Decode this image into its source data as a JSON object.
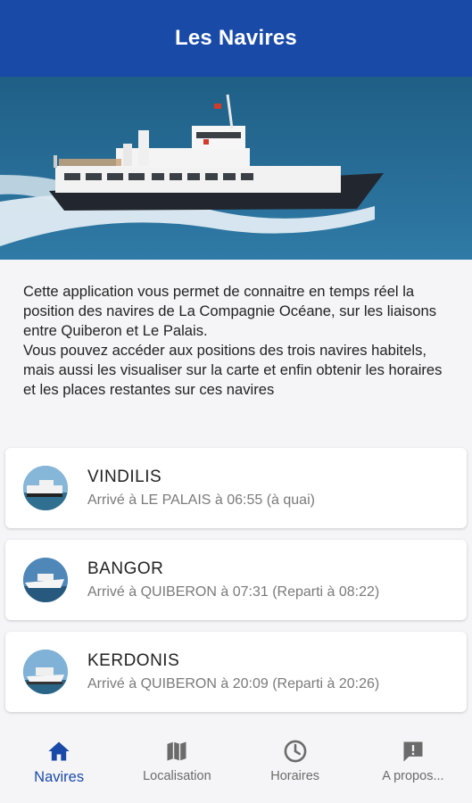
{
  "header": {
    "title": "Les Navires"
  },
  "intro": {
    "paragraph1": "Cette application vous permet de connaitre en temps réel la position des navires de La Compagnie Océane, sur les liaisons entre Quiberon et Le Palais.",
    "paragraph2": "Vous pouvez accéder aux positions des trois navires habitels, mais aussi les visualiser sur la carte et enfin obtenir les horaires et les places restantes sur ces navires"
  },
  "ships": [
    {
      "name": "VINDILIS",
      "status": "Arrivé à LE PALAIS à 06:55 (à quai)"
    },
    {
      "name": "BANGOR",
      "status": "Arrivé à QUIBERON à 07:31 (Reparti à 08:22)"
    },
    {
      "name": "KERDONIS",
      "status": "Arrivé à QUIBERON à 20:09 (Reparti à 20:26)"
    }
  ],
  "tabs": [
    {
      "label": "Navires",
      "icon": "home-icon",
      "active": true
    },
    {
      "label": "Localisation",
      "icon": "map-icon",
      "active": false
    },
    {
      "label": "Horaires",
      "icon": "clock-icon",
      "active": false
    },
    {
      "label": "A propos...",
      "icon": "message-icon",
      "active": false
    }
  ],
  "colors": {
    "primary": "#1a4aa8",
    "inactive": "#6b6b6b",
    "sea": "#2a6f96"
  }
}
